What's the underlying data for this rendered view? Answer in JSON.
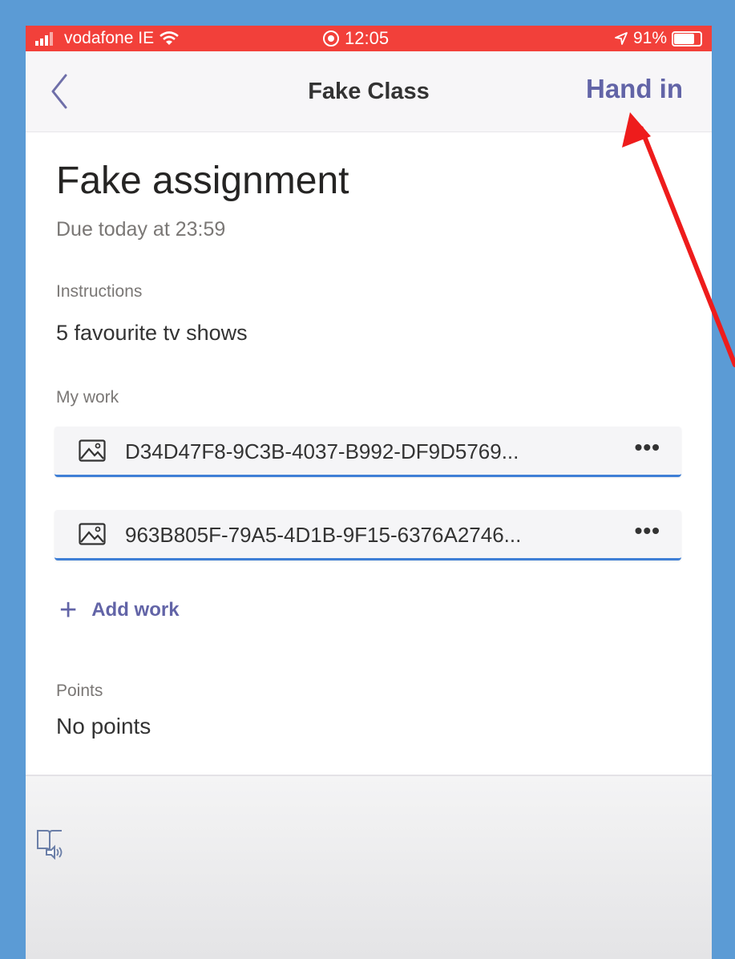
{
  "status_bar": {
    "carrier": "vodafone IE",
    "time": "12:05",
    "battery": "91%",
    "battery_level": 0.91
  },
  "nav": {
    "title": "Fake Class",
    "hand_in_label": "Hand in"
  },
  "assignment": {
    "title": "Fake assignment",
    "due": "Due today at 23:59",
    "instructions_label": "Instructions",
    "instructions": "5 favourite tv shows",
    "my_work_label": "My work",
    "files": [
      {
        "name": "D34D47F8-9C3B-4037-B992-DF9D5769...",
        "more": "•••",
        "icon": "image-file-icon"
      },
      {
        "name": "963B805F-79A5-4D1B-9F15-6376A2746...",
        "more": "•••",
        "icon": "image-file-icon"
      }
    ],
    "add_work_label": "Add work",
    "points_label": "Points",
    "points_value": "No points"
  },
  "colors": {
    "status_bar": "#f2403a",
    "accent": "#6264a7",
    "file_underline": "#3f7fd6",
    "annotation_arrow": "#ee1c1c",
    "frame": "#5b9bd5"
  },
  "icons": [
    "signal-icon",
    "wifi-icon",
    "alarm-icon",
    "location-icon",
    "battery-icon",
    "back-chevron-icon",
    "image-file-icon",
    "more-icon",
    "plus-icon",
    "immersive-reader-icon",
    "annotation-arrow"
  ]
}
